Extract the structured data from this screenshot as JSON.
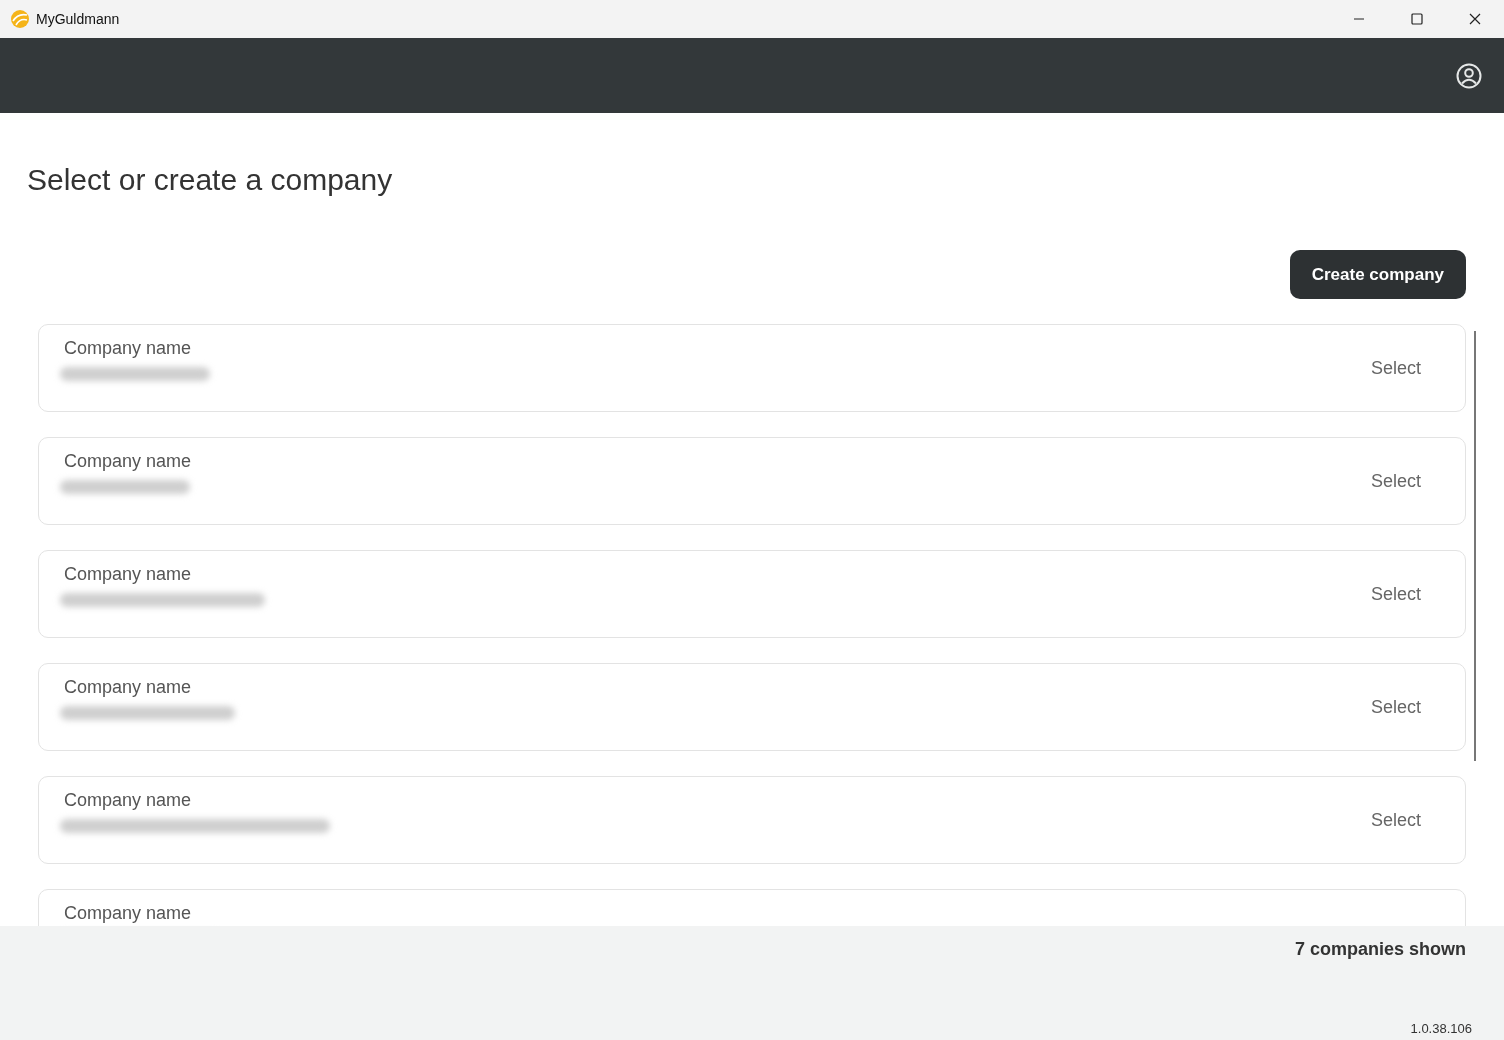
{
  "window": {
    "title": "MyGuldmann"
  },
  "page": {
    "heading": "Select or create a company",
    "create_button": "Create company"
  },
  "companies": [
    {
      "label": "Company name",
      "action": "Select"
    },
    {
      "label": "Company name",
      "action": "Select"
    },
    {
      "label": "Company name",
      "action": "Select"
    },
    {
      "label": "Company name",
      "action": "Select"
    },
    {
      "label": "Company name",
      "action": "Select"
    },
    {
      "label": "Company name"
    }
  ],
  "footer": {
    "count": "7 companies shown",
    "version": "1.0.38.106"
  }
}
